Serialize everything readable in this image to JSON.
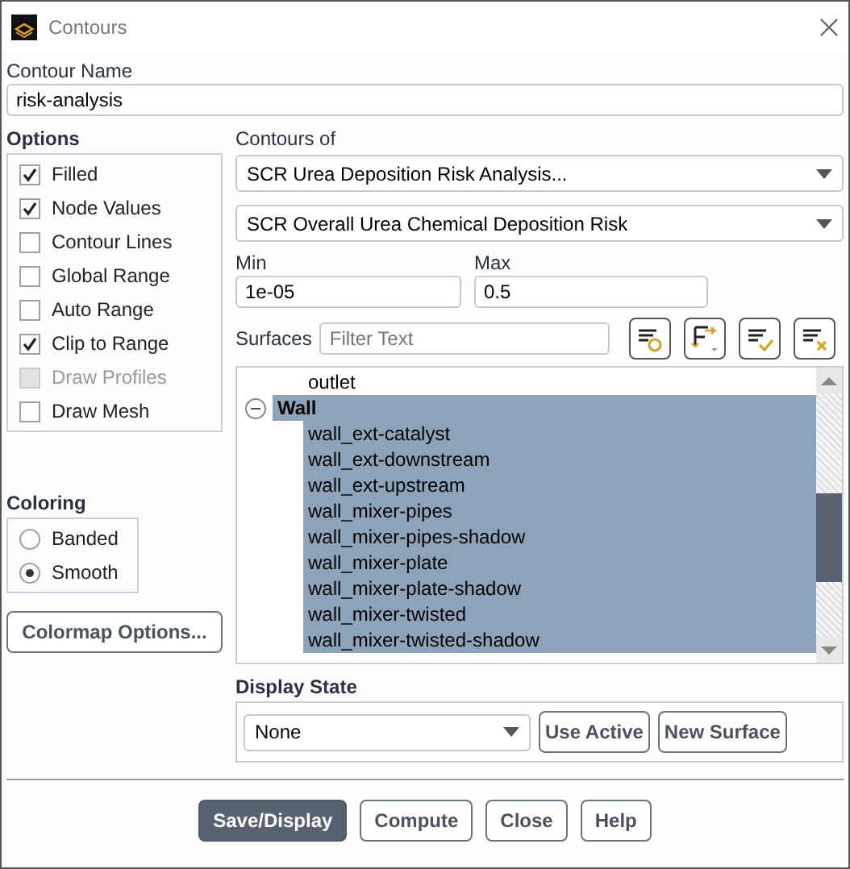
{
  "window": {
    "title": "Contours"
  },
  "contour_name": {
    "label": "Contour Name",
    "value": "risk-analysis"
  },
  "options": {
    "title": "Options",
    "items": [
      {
        "label": "Filled",
        "checked": true,
        "disabled": false
      },
      {
        "label": "Node Values",
        "checked": true,
        "disabled": false
      },
      {
        "label": "Contour Lines",
        "checked": false,
        "disabled": false
      },
      {
        "label": "Global Range",
        "checked": false,
        "disabled": false
      },
      {
        "label": "Auto Range",
        "checked": false,
        "disabled": false
      },
      {
        "label": "Clip to Range",
        "checked": true,
        "disabled": false
      },
      {
        "label": "Draw Profiles",
        "checked": false,
        "disabled": true
      },
      {
        "label": "Draw Mesh",
        "checked": false,
        "disabled": false
      }
    ]
  },
  "coloring": {
    "title": "Coloring",
    "items": [
      {
        "label": "Banded",
        "selected": false
      },
      {
        "label": "Smooth",
        "selected": true
      }
    ]
  },
  "colormap_button": "Colormap Options...",
  "contours_of": {
    "label": "Contours of",
    "primary": "SCR Urea Deposition Risk Analysis...",
    "secondary": "SCR Overall Urea Chemical Deposition Risk"
  },
  "min": {
    "label": "Min",
    "value": "1e-05"
  },
  "max": {
    "label": "Max",
    "value": "0.5"
  },
  "surfaces": {
    "label": "Surfaces",
    "filter_placeholder": "Filter Text",
    "items": [
      {
        "kind": "leaf",
        "label": "outlet",
        "selected": false
      },
      {
        "kind": "group",
        "label": "Wall",
        "selected": true,
        "expanded": true,
        "children": [
          {
            "label": "wall_ext-catalyst",
            "selected": true
          },
          {
            "label": "wall_ext-downstream",
            "selected": true
          },
          {
            "label": "wall_ext-upstream",
            "selected": true
          },
          {
            "label": "wall_mixer-pipes",
            "selected": true
          },
          {
            "label": "wall_mixer-pipes-shadow",
            "selected": true
          },
          {
            "label": "wall_mixer-plate",
            "selected": true
          },
          {
            "label": "wall_mixer-plate-shadow",
            "selected": true
          },
          {
            "label": "wall_mixer-twisted",
            "selected": true
          },
          {
            "label": "wall_mixer-twisted-shadow",
            "selected": true
          }
        ]
      }
    ]
  },
  "display_state": {
    "title": "Display State",
    "value": "None",
    "buttons": [
      "Use Active",
      "New Surface"
    ]
  },
  "footer_buttons": [
    {
      "label": "Save/Display",
      "primary": true
    },
    {
      "label": "Compute",
      "primary": false
    },
    {
      "label": "Close",
      "primary": false
    },
    {
      "label": "Help",
      "primary": false
    }
  ]
}
